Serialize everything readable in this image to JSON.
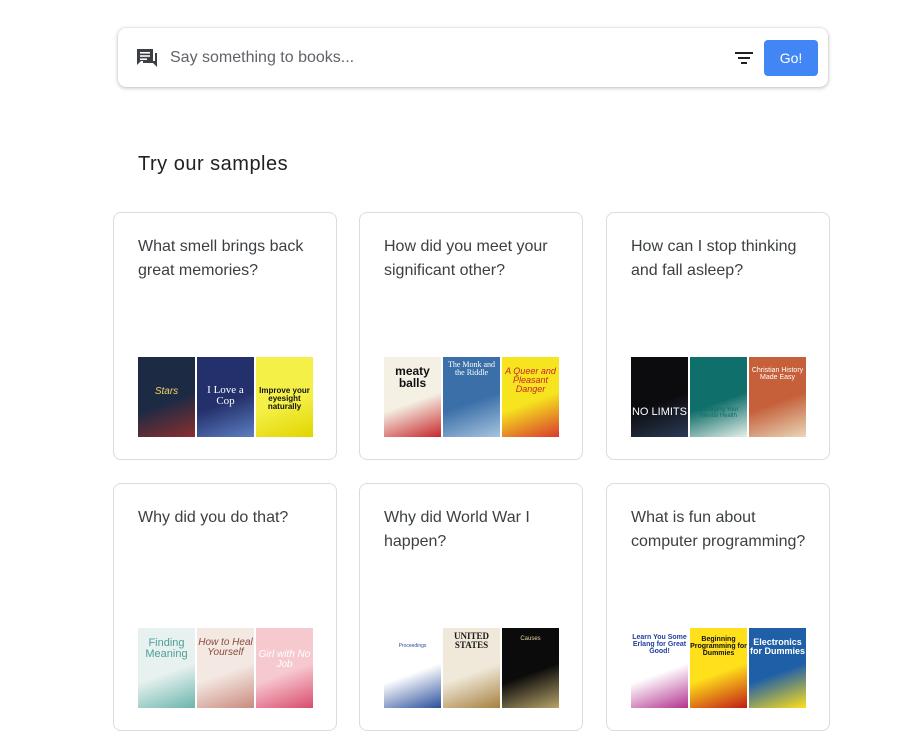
{
  "search": {
    "placeholder": "Say something to books...",
    "go_label": "Go!"
  },
  "samples": {
    "heading": "Try our samples",
    "cards": [
      {
        "question": "What smell brings back great memories?",
        "covers": [
          {
            "title": "Stars",
            "colors": [
              "#1d2a44",
              "#8a2f2f"
            ]
          },
          {
            "title": "I Love a Cop",
            "colors": [
              "#24306b",
              "#5c7fc2"
            ]
          },
          {
            "title": "Improve your eyesight naturally",
            "colors": [
              "#f5f047",
              "#e0d500"
            ]
          }
        ]
      },
      {
        "question": "How did you meet your significant other?",
        "covers": [
          {
            "title": "meaty balls",
            "colors": [
              "#f4f0e4",
              "#c8262b"
            ]
          },
          {
            "title": "The Monk and the Riddle",
            "colors": [
              "#3a6fa8",
              "#a7c4de"
            ]
          },
          {
            "title": "A Queer and Pleasant Danger",
            "colors": [
              "#f6e41e",
              "#d83a2e"
            ]
          }
        ]
      },
      {
        "question": "How can I stop thinking and fall asleep?",
        "covers": [
          {
            "title": "NO LIMITS",
            "colors": [
              "#0c0c0f",
              "#2b3a55"
            ]
          },
          {
            "title": "Managing Your Mental Health",
            "colors": [
              "#0f6f6a",
              "#e7efe9"
            ]
          },
          {
            "title": "Christian History Made Easy",
            "colors": [
              "#c5603b",
              "#e9d7b8"
            ]
          }
        ]
      },
      {
        "question": "Why did you do that?",
        "covers": [
          {
            "title": "Finding Meaning",
            "colors": [
              "#e7f1ef",
              "#6ab5ad"
            ]
          },
          {
            "title": "How to Heal Yourself",
            "colors": [
              "#f3e8e2",
              "#c98a7d"
            ]
          },
          {
            "title": "Girl with No Job",
            "colors": [
              "#f6c9cf",
              "#d94b6f"
            ]
          }
        ]
      },
      {
        "question": "Why did World War I happen?",
        "covers": [
          {
            "title": "Proceedings",
            "colors": [
              "#ffffff",
              "#2a4f9b"
            ]
          },
          {
            "title": "UNITED STATES",
            "colors": [
              "#f0e9da",
              "#a6803f"
            ]
          },
          {
            "title": "Causes",
            "colors": [
              "#0b0b0b",
              "#b8a46a"
            ]
          }
        ]
      },
      {
        "question": "What is fun about computer programming?",
        "covers": [
          {
            "title": "Learn You Some Erlang for Great Good!",
            "colors": [
              "#ffffff",
              "#b2328f"
            ]
          },
          {
            "title": "Beginning Programming for Dummies",
            "colors": [
              "#ffe01a",
              "#c11b17"
            ]
          },
          {
            "title": "Electronics for Dummies",
            "colors": [
              "#1f5fa8",
              "#ffe01a"
            ]
          }
        ]
      }
    ]
  }
}
